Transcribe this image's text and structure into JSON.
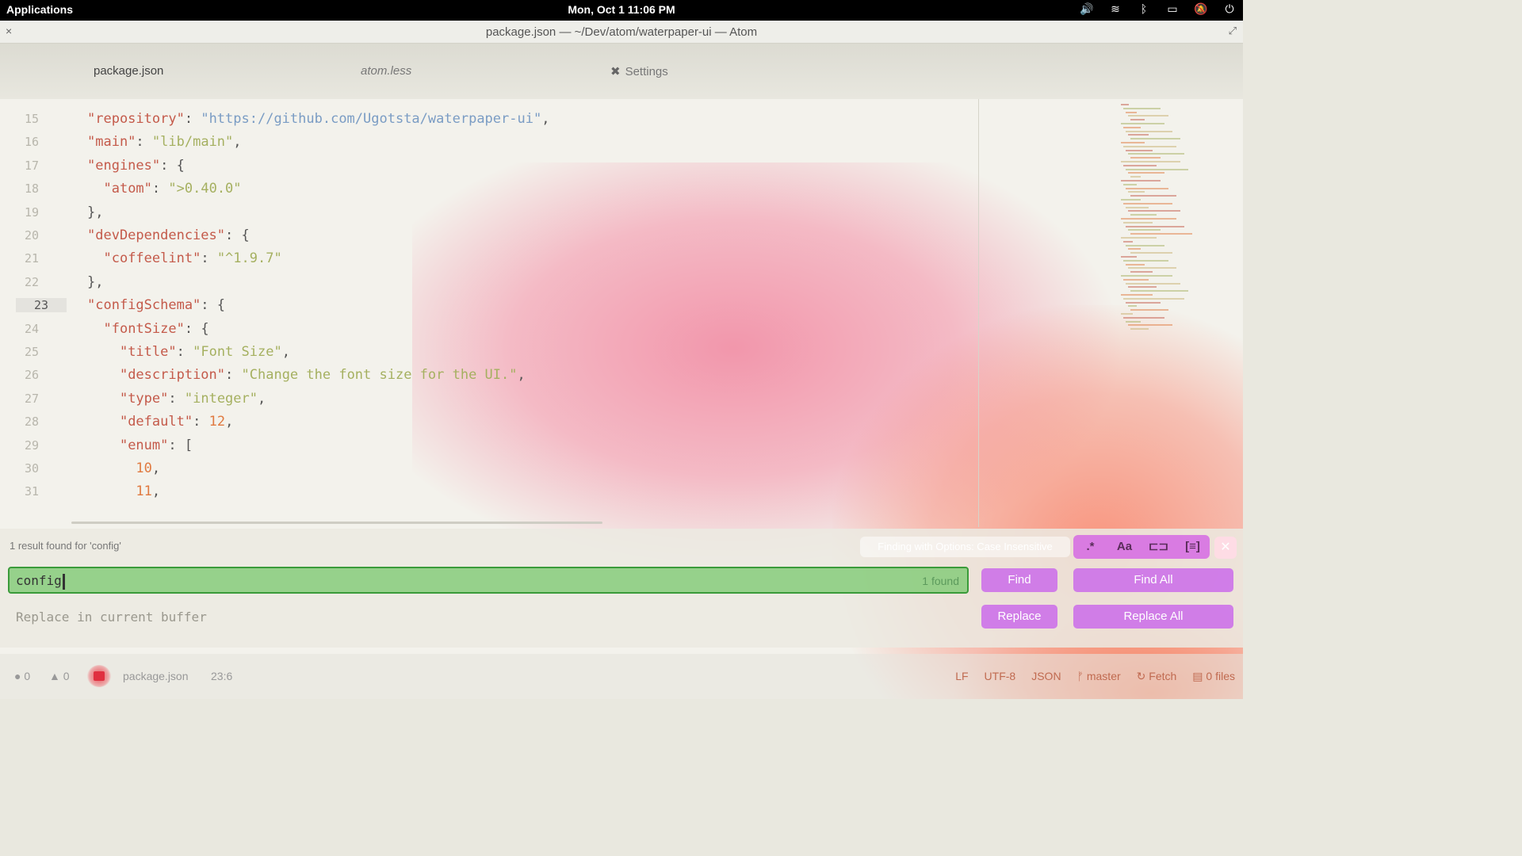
{
  "system_bar": {
    "applications_label": "Applications",
    "clock": "Mon, Oct  1  11:06 PM",
    "tray_icons": [
      "volume-icon",
      "wifi-icon",
      "bluetooth-icon",
      "battery-icon",
      "notifications-off-icon",
      "power-icon"
    ]
  },
  "window": {
    "title": "package.json — ~/Dev/atom/waterpaper-ui — Atom",
    "close_glyph": "×",
    "maximize_glyph": "⤢"
  },
  "tabs": [
    {
      "label": "package.json",
      "active": true
    },
    {
      "label": "atom.less",
      "active": false
    },
    {
      "label": "Settings",
      "active": false,
      "icon": "wrench-icon"
    }
  ],
  "editor": {
    "current_line": 23,
    "lines": [
      {
        "n": "15",
        "code": "\"repository\": \"https://github.com/Ugotsta/waterpaper-ui\","
      },
      {
        "n": "16",
        "code": "\"main\": \"lib/main\","
      },
      {
        "n": "17",
        "code": "\"engines\": {"
      },
      {
        "n": "18",
        "code": "  \"atom\": \">0.40.0\""
      },
      {
        "n": "19",
        "code": "},"
      },
      {
        "n": "20",
        "code": "\"devDependencies\": {"
      },
      {
        "n": "21",
        "code": "  \"coffeelint\": \"^1.9.7\""
      },
      {
        "n": "22",
        "code": "},"
      },
      {
        "n": "23",
        "code": "\"configSchema\": {"
      },
      {
        "n": "24",
        "code": "  \"fontSize\": {"
      },
      {
        "n": "25",
        "code": "    \"title\": \"Font Size\","
      },
      {
        "n": "26",
        "code": "    \"description\": \"Change the font size for the UI.\","
      },
      {
        "n": "27",
        "code": "    \"type\": \"integer\","
      },
      {
        "n": "28",
        "code": "    \"default\": 12,"
      },
      {
        "n": "29",
        "code": "    \"enum\": ["
      },
      {
        "n": "30",
        "code": "      10,"
      },
      {
        "n": "31",
        "code": "      11,"
      }
    ]
  },
  "find_panel": {
    "status_text": "1 result found for 'config'",
    "options_summary": "Finding with Options: Case Insensitive",
    "option_buttons": [
      ".*",
      "Aa",
      "⊏⊐",
      "[≡]"
    ],
    "close_glyph": "✕",
    "find_value": "config",
    "result_count": "1 found",
    "replace_placeholder": "Replace in current buffer",
    "find_label": "Find",
    "find_all_label": "Find All",
    "replace_label": "Replace",
    "replace_all_label": "Replace All"
  },
  "status_bar": {
    "errors": "0",
    "warnings": "0",
    "file": "package.json",
    "cursor": "23:6",
    "line_ending": "LF",
    "encoding": "UTF-8",
    "grammar": "JSON",
    "branch": "master",
    "fetch": "Fetch",
    "files": "0 files"
  },
  "colors": {
    "accent_purple": "#c864eb",
    "find_match_green": "#78c86e",
    "paint_pink": "#f27896",
    "paint_orange": "#fa6e50"
  }
}
